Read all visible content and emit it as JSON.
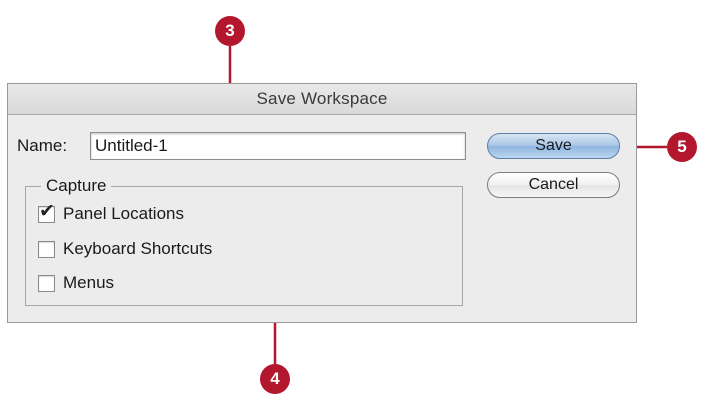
{
  "dialog": {
    "title": "Save Workspace",
    "name_label": "Name:",
    "name_value": "Untitled-1",
    "buttons": {
      "save": "Save",
      "cancel": "Cancel"
    },
    "capture": {
      "legend": "Capture",
      "options": [
        {
          "label": "Panel Locations",
          "checked": true
        },
        {
          "label": "Keyboard Shortcuts",
          "checked": false
        },
        {
          "label": "Menus",
          "checked": false
        }
      ]
    }
  },
  "callouts": {
    "step_3": "3",
    "step_4": "4",
    "step_5": "5"
  },
  "colors": {
    "callout": "#b2172e",
    "save_button": "#a9c6e6",
    "dialog_bg": "#ececec"
  }
}
